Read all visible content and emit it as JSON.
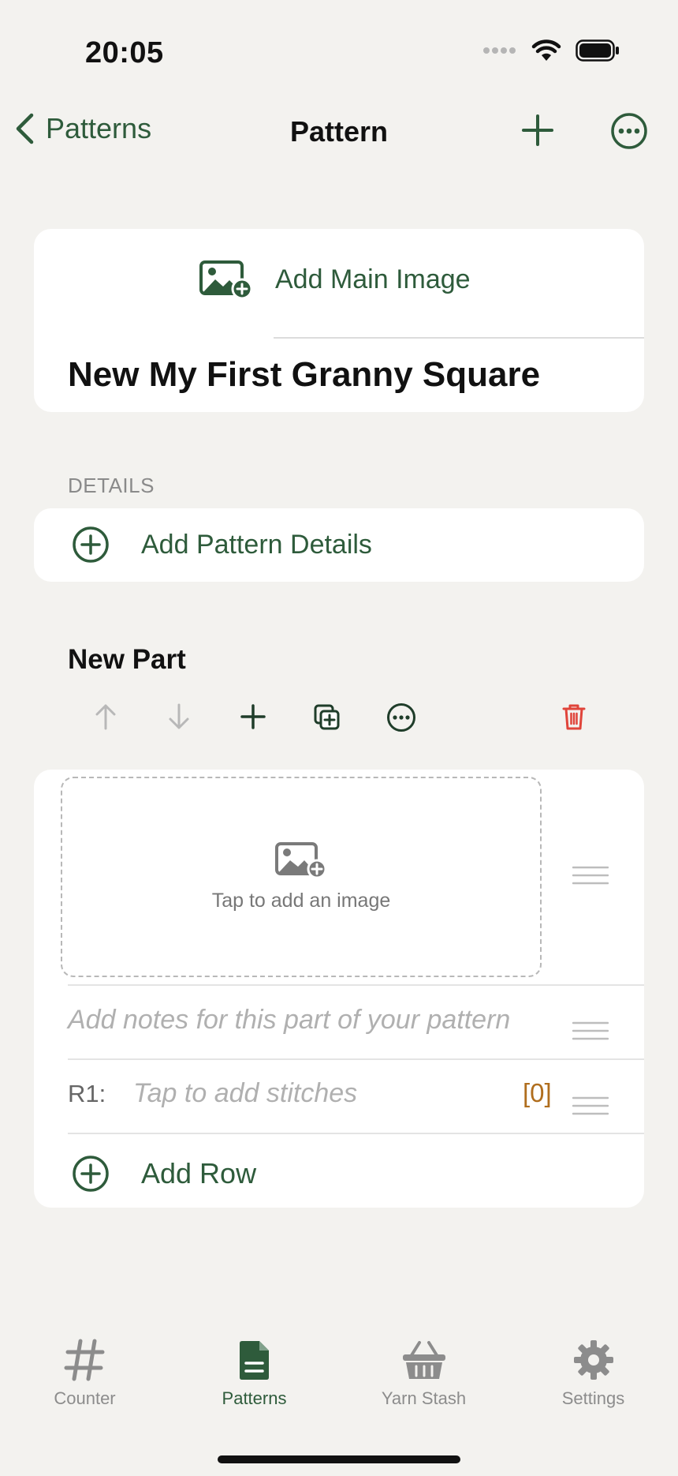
{
  "status_bar": {
    "time": "20:05"
  },
  "nav": {
    "back_label": "Patterns",
    "title": "Pattern"
  },
  "main_card": {
    "add_image_label": "Add Main Image",
    "pattern_title": "New My First Granny Square"
  },
  "details": {
    "section_label": "DETAILS",
    "add_label": "Add Pattern Details"
  },
  "part": {
    "title": "New Part",
    "image_placeholder": "Tap to add an image",
    "notes_placeholder": "Add notes for this part of your pattern",
    "rows": [
      {
        "label": "R1:",
        "placeholder": "Tap to add stitches",
        "count": "[0]"
      }
    ],
    "add_row_label": "Add Row"
  },
  "tabs": [
    {
      "label": "Counter",
      "icon": "hash-icon",
      "active": false
    },
    {
      "label": "Patterns",
      "icon": "document-icon",
      "active": true
    },
    {
      "label": "Yarn Stash",
      "icon": "basket-icon",
      "active": false
    },
    {
      "label": "Settings",
      "icon": "gear-icon",
      "active": false
    }
  ],
  "colors": {
    "accent": "#2e5b3b",
    "delete": "#e0443a",
    "count": "#b06e1e",
    "background": "#f3f2ef"
  }
}
